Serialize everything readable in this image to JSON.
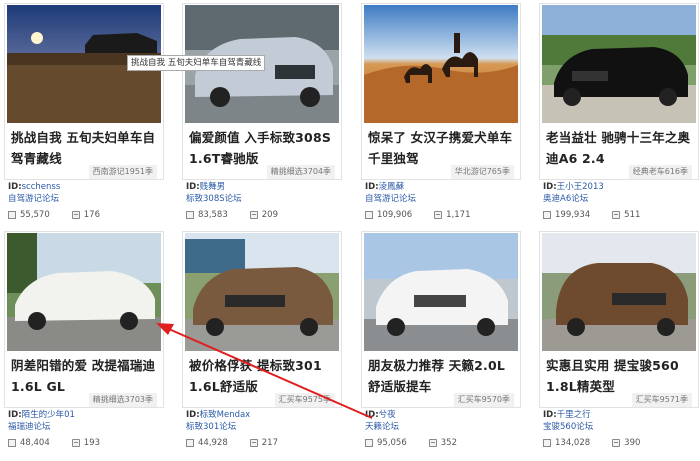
{
  "tooltip": "挑战自我 五旬夫妇单车自驾青藏线",
  "cards": [
    {
      "title": "挑战自我 五旬夫妇单车自驾青藏线",
      "badge": "西南游记1951季",
      "uid_label": "ID:",
      "user": "scchenss",
      "forum": "自驾游记论坛",
      "views": "55,570",
      "comments": "176"
    },
    {
      "title": "偏爱颜值 入手标致308S 1.6T睿驰版",
      "badge": "精挑细选3704季",
      "uid_label": "ID:",
      "user": "贱舞男",
      "forum": "标致308S论坛",
      "views": "83,583",
      "comments": "209"
    },
    {
      "title": "惊呆了 女汉子携爱犬单车千里独驾",
      "badge": "华北游记765季",
      "uid_label": "ID:",
      "user": "淩鳳蘇",
      "forum": "自驾游记论坛",
      "views": "109,906",
      "comments": "1,171"
    },
    {
      "title": "老当益壮 驰骋十三年之奥迪A6 2.4",
      "badge": "经典老车616季",
      "uid_label": "ID:",
      "user": "王小王2013",
      "forum": "奥迪A6论坛",
      "views": "199,934",
      "comments": "511"
    },
    {
      "title": "阴差阳错的爱 改提福瑞迪1.6L GL",
      "badge": "精挑细选3703季",
      "uid_label": "ID:",
      "user": "陌生的少年01",
      "forum": "福瑞迪论坛",
      "views": "48,404",
      "comments": "193"
    },
    {
      "title": "被价格俘获 提标致301 1.6L舒适版",
      "badge": "汇买车9575季",
      "uid_label": "ID:",
      "user": "标致Mendax",
      "forum": "标致301论坛",
      "views": "44,928",
      "comments": "217"
    },
    {
      "title": "朋友极力推荐 天籁2.0L舒适版提车",
      "badge": "汇买车9570季",
      "uid_label": "ID:",
      "user": "兮夜",
      "forum": "天籁论坛",
      "views": "95,056",
      "comments": "352"
    },
    {
      "title": "实惠且实用 提宝骏560 1.8L精英型",
      "badge": "汇买车9571季",
      "uid_label": "ID:",
      "user": "千里之行",
      "forum": "宝骏560论坛",
      "views": "134,028",
      "comments": "390"
    }
  ]
}
